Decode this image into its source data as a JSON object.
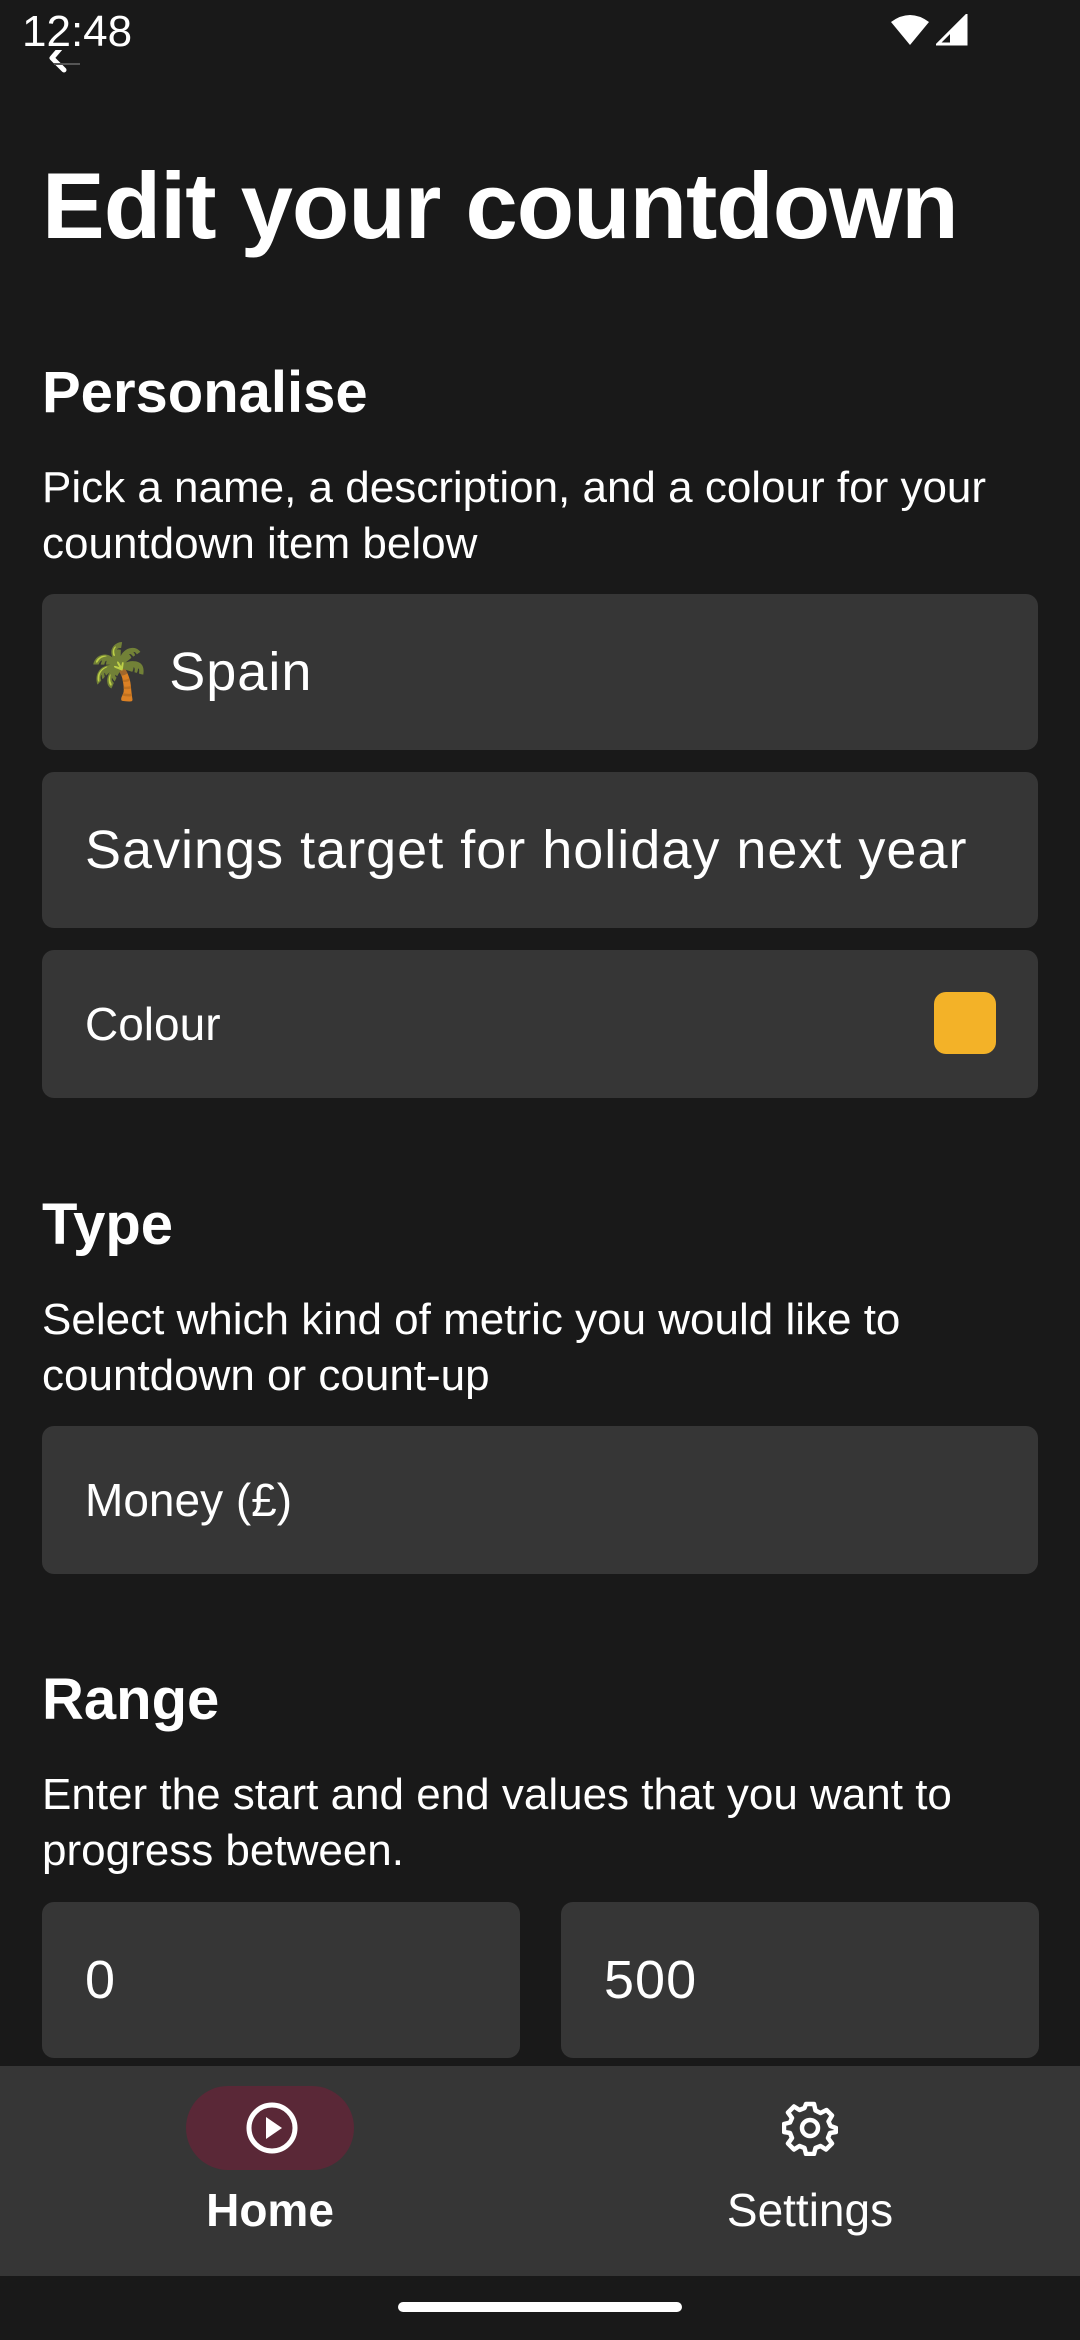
{
  "status_bar": {
    "time": "12:48",
    "icons": [
      "wifi-icon",
      "cell-signal-icon"
    ]
  },
  "header": {
    "back_icon": "back-arrow-icon",
    "title": "Edit your countdown"
  },
  "personalise": {
    "title": "Personalise",
    "description": "Pick a name, a description, and a colour for your countdown item below",
    "name_value": "🌴 Spain",
    "description_value": "Savings target for holiday next year",
    "colour_label": "Colour",
    "colour_value": "#F3B228"
  },
  "type": {
    "title": "Type",
    "description": "Select which kind of metric you would like to countdown or count-up",
    "selected": "Money (£)"
  },
  "range": {
    "title": "Range",
    "description": "Enter the start and end values that you want to progress between.",
    "start_value": "0",
    "end_value": "500"
  },
  "bottom_nav": {
    "items": [
      {
        "label": "Home",
        "icon": "play-circle-icon",
        "active": true
      },
      {
        "label": "Settings",
        "icon": "gear-icon",
        "active": false
      }
    ],
    "active_pill_color": "#5A2837"
  },
  "colors": {
    "background": "#191919",
    "surface": "#363636",
    "text": "#FFFFFF"
  }
}
